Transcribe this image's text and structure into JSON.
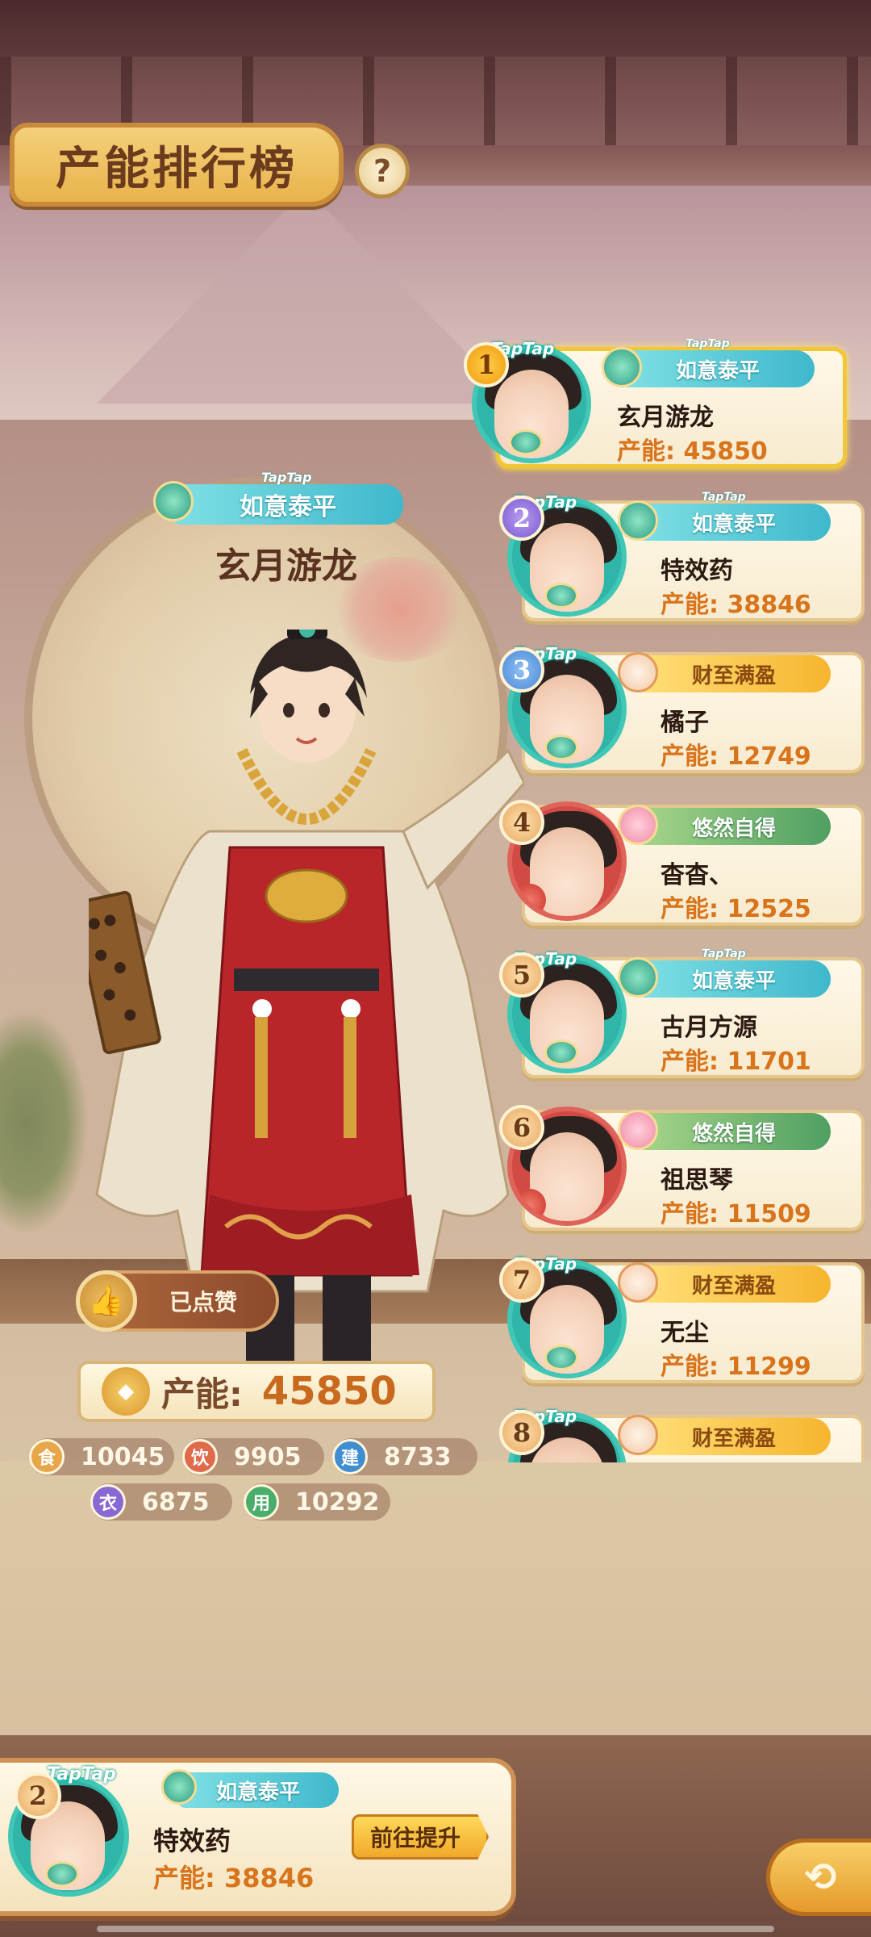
{
  "header": {
    "title": "产能排行榜",
    "help_glyph": "?"
  },
  "featured": {
    "badge": "如意泰平",
    "badge_logo": "TapTap",
    "name": "玄月游龙",
    "like_label": "已点赞",
    "capacity_label": "产能:",
    "capacity_value": "45850",
    "stats": [
      {
        "icon": "食",
        "value": "10045",
        "color": "#e8a64a"
      },
      {
        "icon": "饮",
        "value": "9905",
        "color": "#e06a4c"
      },
      {
        "icon": "建",
        "value": "8733",
        "color": "#3e8ed0"
      },
      {
        "icon": "衣",
        "value": "6875",
        "color": "#8a68d4"
      },
      {
        "icon": "用",
        "value": "10292",
        "color": "#4aae6a"
      }
    ]
  },
  "leaderboard": [
    {
      "rank": "1",
      "name": "玄月游龙",
      "capacity": "产能: 45850",
      "badge": "如意泰平",
      "badge_style": "teal",
      "logo": "TapTap"
    },
    {
      "rank": "2",
      "name": "特效药",
      "capacity": "产能: 38846",
      "badge": "如意泰平",
      "badge_style": "teal",
      "logo": "TapTap"
    },
    {
      "rank": "3",
      "name": "橘子",
      "capacity": "产能: 12749",
      "badge": "财至满盈",
      "badge_style": "gold",
      "logo": "TapTap"
    },
    {
      "rank": "4",
      "name": "杳杳、",
      "capacity": "产能: 12525",
      "badge": "悠然自得",
      "badge_style": "green",
      "logo": ""
    },
    {
      "rank": "5",
      "name": "古月方源",
      "capacity": "产能: 11701",
      "badge": "如意泰平",
      "badge_style": "teal",
      "logo": "TapTap"
    },
    {
      "rank": "6",
      "name": "祖思琴",
      "capacity": "产能: 11509",
      "badge": "悠然自得",
      "badge_style": "green",
      "logo": ""
    },
    {
      "rank": "7",
      "name": "无尘",
      "capacity": "产能: 11299",
      "badge": "财至满盈",
      "badge_style": "gold",
      "logo": "TapTap"
    },
    {
      "rank": "8",
      "name": "",
      "capacity": "",
      "badge": "财至满盈",
      "badge_style": "gold",
      "logo": "TapTap"
    }
  ],
  "self": {
    "rank": "2",
    "logo": "TapTap",
    "badge": "如意泰平",
    "name": "特效药",
    "capacity": "产能: 38846",
    "go_label": "前往提升"
  },
  "colors": {
    "accent": "#d8741c",
    "card_bg": "#fff8e8",
    "title_bar": "#e9b34c"
  }
}
